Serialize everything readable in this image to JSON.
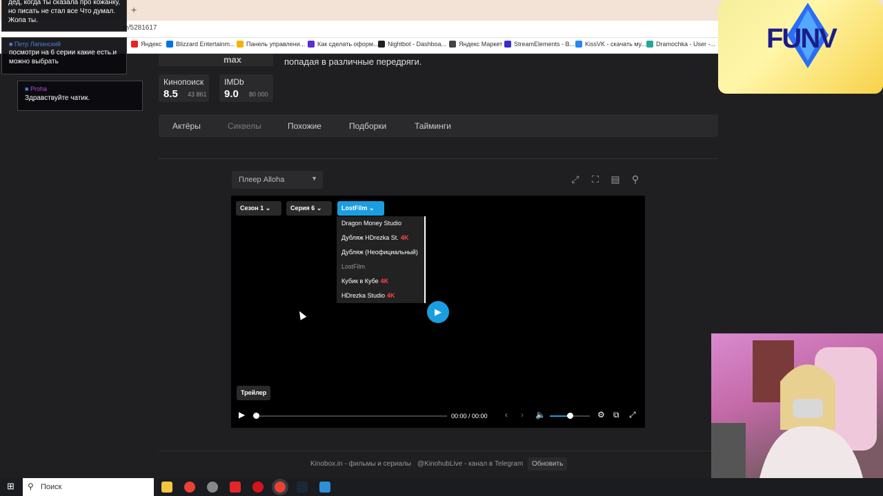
{
  "browser": {
    "url_fragment": "ie/5281617",
    "bookmarks": [
      {
        "label": "Яндекс",
        "color": "#e52620"
      },
      {
        "label": "Blizzard Entertainm...",
        "color": "#0074e0"
      },
      {
        "label": "Панель управлени...",
        "color": "#f5b400"
      },
      {
        "label": "Как сделать оформ...",
        "color": "#5a2ed6"
      },
      {
        "label": "Nightbot - Dashboa...",
        "color": "#222222"
      },
      {
        "label": "Яндекс Маркет",
        "color": "#444444"
      },
      {
        "label": "StreamElements - B...",
        "color": "#3a2bd0"
      },
      {
        "label": "KissVK - скачать му...",
        "color": "#2787f5"
      },
      {
        "label": "Dramochka - User -...",
        "color": "#26a69a"
      }
    ]
  },
  "movie": {
    "poster_text": "max",
    "description": "попадая в различные передряги.",
    "ratings": [
      {
        "source": "Кинопоиск",
        "value": "8.5",
        "count": "43 861"
      },
      {
        "source": "IMDb",
        "value": "9.0",
        "count": "80 000"
      }
    ],
    "tabs": [
      "Актёры",
      "Сиквелы",
      "Похожие",
      "Подборки",
      "Тайминги"
    ]
  },
  "player": {
    "selector": "Плеер Alloha",
    "season": "Сезон 1",
    "episode": "Серия 6",
    "voice": "LostFilm",
    "voices": [
      {
        "name": "Dragon Money Studio",
        "badge": ""
      },
      {
        "name": "Дубляж HDrezka St.",
        "badge": "4K"
      },
      {
        "name": "Дубляж (Неофициальный)",
        "badge": ""
      },
      {
        "name": "LostFilm",
        "badge": ""
      },
      {
        "name": "Кубик в Кубе",
        "badge": "4K"
      },
      {
        "name": "HDrezka Studio",
        "badge": "4K"
      }
    ],
    "trailer": "Трейлер",
    "time": "00:00 / 00:00",
    "progress": 0,
    "volume": 0.5,
    "accent": "#1a9ee0"
  },
  "footer": {
    "site": "Kinobox.in - фильмы и сериалы",
    "telegram": "@KinohubLive - канал в Telegram",
    "refresh": "Обновить"
  },
  "chat": [
    {
      "user": "",
      "message": "дед, когда ты сказала про кожанку, но писать не стал все Что думал. Жопа ты."
    },
    {
      "user": "Петр Лапинский",
      "message": "посмотри на 6 серии какие есть.и можно выбрать"
    },
    {
      "user": "Proha",
      "message": "Здравствуйте чатик."
    }
  ],
  "stream_logo": "FUNV",
  "taskbar": {
    "search_placeholder": "Поиск"
  }
}
